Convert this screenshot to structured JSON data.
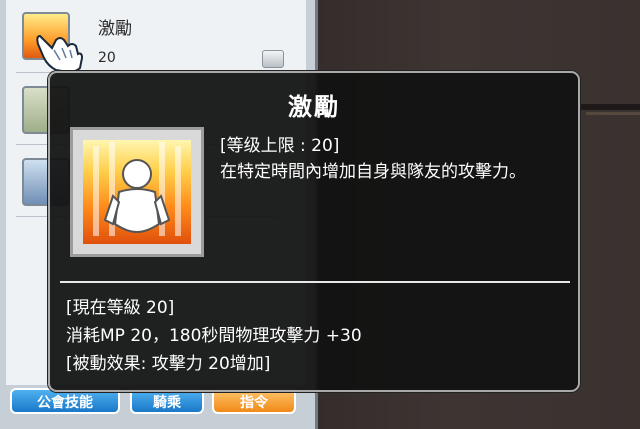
{
  "skill_list": {
    "rows": [
      {
        "name": "激勵",
        "level": "20",
        "icon": "fire-aura-icon"
      },
      {
        "name": "",
        "level": "",
        "icon": "sword-skill-icon"
      },
      {
        "name": "",
        "level": "",
        "icon": "bow-skill-icon"
      }
    ],
    "buttons": {
      "guild": "公會技能",
      "ride": "騎乘",
      "macro": "指令"
    }
  },
  "tooltip": {
    "title": "激勵",
    "level_limit": "[等级上限 : 20]",
    "description": "在特定時間內增加自身與隊友的攻擊力。",
    "current_level": "[現在等級 20]",
    "effect": "消耗MP 20，180秒間物理攻擊力 +30",
    "passive": "[被動效果: 攻擊力 20增加]",
    "icon": "fire-aura-icon"
  }
}
